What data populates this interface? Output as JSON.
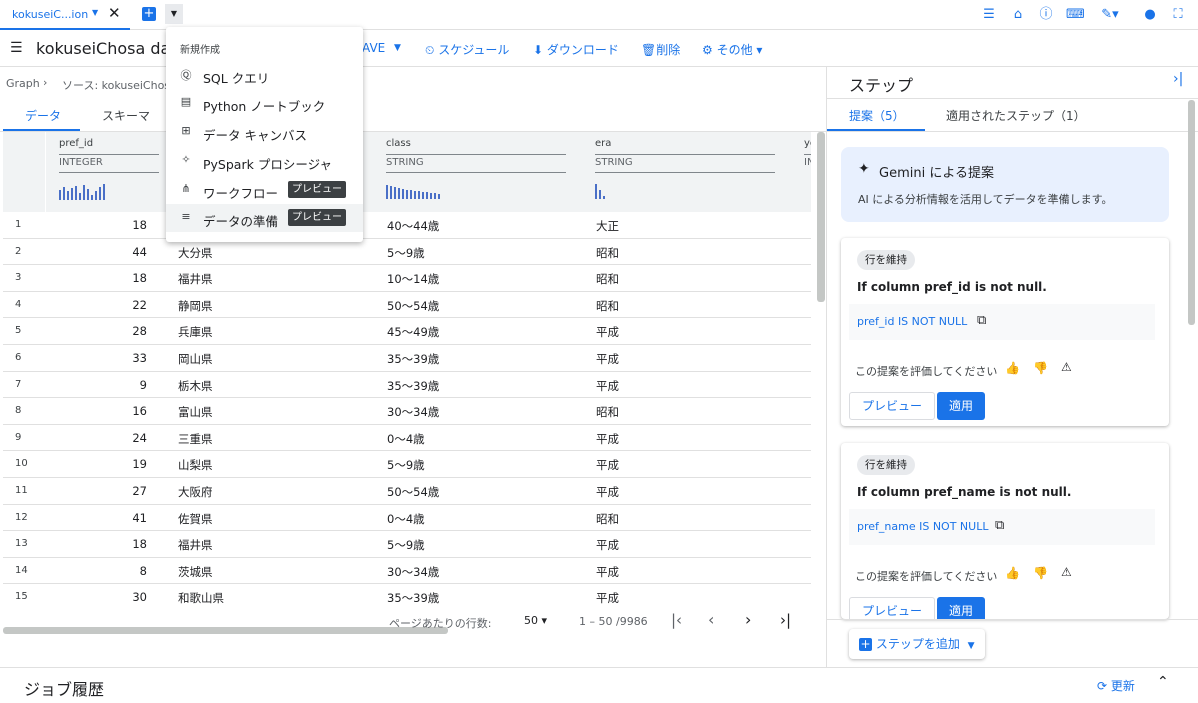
{
  "tab": {
    "label": "kokuseiC...ion"
  },
  "toolbar": {
    "title": "kokuseiChosa data",
    "save": "AVE",
    "schedule": "スケジュール",
    "download": "ダウンロード",
    "delete": "削除",
    "more": "その他"
  },
  "breadcrumb": {
    "graph": "Graph",
    "source": "ソース: kokuseiChos"
  },
  "subtabs": {
    "data": "データ",
    "schema": "スキーマ"
  },
  "menu": {
    "header": "新規作成",
    "items": [
      {
        "label": "SQL クエリ",
        "icon": "sql-icon"
      },
      {
        "label": "Python ノートブック",
        "icon": "notebook-icon"
      },
      {
        "label": "データ キャンバス",
        "icon": "canvas-icon"
      },
      {
        "label": "PySpark プロシージャ",
        "icon": "pyspark-icon"
      },
      {
        "label": "ワークフロー",
        "icon": "workflow-icon",
        "badge": "プレビュー"
      },
      {
        "label": "データの準備",
        "icon": "data-prep-icon",
        "badge": "プレビュー"
      }
    ]
  },
  "grid": {
    "columns": [
      {
        "name": "pref_id",
        "type": "INTEGER"
      },
      {
        "name": "class",
        "type": "STRING"
      },
      {
        "name": "era",
        "type": "STRING"
      },
      {
        "name": "ye",
        "type": "IN"
      }
    ],
    "rows": [
      {
        "n": "1",
        "pref_id": "18",
        "pref_name": "",
        "class": "40〜44歳",
        "era": "大正"
      },
      {
        "n": "2",
        "pref_id": "44",
        "pref_name": "大分県",
        "class": "5〜9歳",
        "era": "昭和"
      },
      {
        "n": "3",
        "pref_id": "18",
        "pref_name": "福井県",
        "class": "10〜14歳",
        "era": "昭和"
      },
      {
        "n": "4",
        "pref_id": "22",
        "pref_name": "静岡県",
        "class": "50〜54歳",
        "era": "昭和"
      },
      {
        "n": "5",
        "pref_id": "28",
        "pref_name": "兵庫県",
        "class": "45〜49歳",
        "era": "平成"
      },
      {
        "n": "6",
        "pref_id": "33",
        "pref_name": "岡山県",
        "class": "35〜39歳",
        "era": "平成"
      },
      {
        "n": "7",
        "pref_id": "9",
        "pref_name": "栃木県",
        "class": "35〜39歳",
        "era": "平成"
      },
      {
        "n": "8",
        "pref_id": "16",
        "pref_name": "富山県",
        "class": "30〜34歳",
        "era": "昭和"
      },
      {
        "n": "9",
        "pref_id": "24",
        "pref_name": "三重県",
        "class": "0〜4歳",
        "era": "平成"
      },
      {
        "n": "10",
        "pref_id": "19",
        "pref_name": "山梨県",
        "class": "5〜9歳",
        "era": "平成"
      },
      {
        "n": "11",
        "pref_id": "27",
        "pref_name": "大阪府",
        "class": "50〜54歳",
        "era": "平成"
      },
      {
        "n": "12",
        "pref_id": "41",
        "pref_name": "佐賀県",
        "class": "0〜4歳",
        "era": "昭和"
      },
      {
        "n": "13",
        "pref_id": "18",
        "pref_name": "福井県",
        "class": "5〜9歳",
        "era": "平成"
      },
      {
        "n": "14",
        "pref_id": "8",
        "pref_name": "茨城県",
        "class": "30〜34歳",
        "era": "平成"
      },
      {
        "n": "15",
        "pref_id": "30",
        "pref_name": "和歌山県",
        "class": "35〜39歳",
        "era": "平成"
      }
    ]
  },
  "pager": {
    "rows_per_page_label": "ページあたりの行数:",
    "rows_per_page": "50",
    "range": "1 – 50 /9986"
  },
  "steps": {
    "title": "ステップ",
    "tab_suggestions": "提案（5）",
    "tab_applied": "適用されたステップ（1）",
    "gemini_title": "Gemini による提案",
    "gemini_desc": "AI による分析情報を活用してデータを準備します。",
    "cards": [
      {
        "chip": "行を維持",
        "condition": "If column pref_id is not null.",
        "code": "pref_id IS NOT NULL",
        "rate": "この提案を評価してください",
        "preview": "プレビュー",
        "apply": "適用"
      },
      {
        "chip": "行を維持",
        "condition": "If column pref_name is not null.",
        "code": "pref_name IS NOT NULL",
        "rate": "この提案を評価してください",
        "preview": "プレビュー",
        "apply": "適用"
      }
    ],
    "add_step": "ステップを追加"
  },
  "bottom": {
    "title": "ジョブ履歴",
    "refresh": "更新"
  },
  "colors": {
    "accent": "#1a73e8",
    "badge": "#3c4043"
  }
}
